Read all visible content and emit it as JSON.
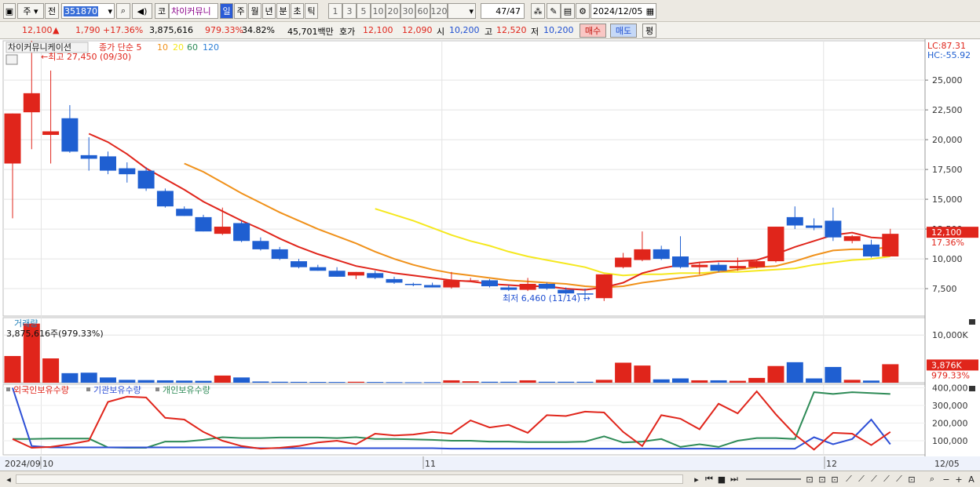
{
  "toolbar": {
    "market_label": "주",
    "prev_label": "전",
    "code": "351870",
    "market_short": "코",
    "stock_name": "차이커뮤니",
    "period_tabs": [
      "일",
      "주",
      "월",
      "년",
      "분",
      "초",
      "틱"
    ],
    "active_period": "일",
    "interval_buttons": [
      "1",
      "3",
      "5",
      "10",
      "20",
      "30",
      "60",
      "120"
    ],
    "page_count": "47/47",
    "date": "2024/12/05"
  },
  "infobar": {
    "price": "12,100",
    "change_arrow": "▲",
    "change": "1,790",
    "change_pct": "+17.36%",
    "volume": "3,875,616",
    "volume_ratio": "979.33%",
    "turnover": "34.82%",
    "trade_value": "45,701백만",
    "quote_label": "호가",
    "ask": "12,100",
    "bid": "12,090",
    "open_label": "시",
    "open": "10,200",
    "high_label": "고",
    "high": "12,520",
    "low_label": "저",
    "low": "10,200",
    "buy_label": "매수",
    "sell_label": "매도",
    "flat_label": "평"
  },
  "colors": {
    "up": "#e0251b",
    "down": "#1f5fd1",
    "ma5": "#e0251b",
    "ma10": "#f0911a",
    "ma20": "#f5e81e",
    "foreign": "#e0251b",
    "institution": "#2d4fd6",
    "individual": "#2e8b57"
  },
  "chart_data": [
    {
      "type": "candlestick",
      "title": "차이커뮤니케이션",
      "legend": [
        "종가 단순 5",
        "10",
        "20",
        "60",
        "120"
      ],
      "annotations": {
        "high_label": "최고 27,450 (09/30)",
        "low_label": "최저 6,460 (11/14)",
        "lc": "LC:87.31",
        "hc": "HC:-55.92",
        "last_price_label": "12,100",
        "last_pct_label": "17.36%"
      },
      "y_ticks": [
        7500,
        10000,
        12500,
        15000,
        17500,
        20000,
        22500,
        25000
      ],
      "y_tick_labels": [
        "7,500",
        "10,000",
        "12,500",
        "15,000",
        "17,500",
        "20,000",
        "22,500",
        "25,000"
      ],
      "ylim": [
        5200,
        28300
      ],
      "x_labels": [
        "2024/09",
        "10",
        "11",
        "12",
        "12/05"
      ],
      "candles": [
        {
          "o": 18000,
          "h": 22200,
          "l": 13400,
          "c": 22200
        },
        {
          "o": 22300,
          "h": 28300,
          "l": 19200,
          "c": 23900
        },
        {
          "o": 20400,
          "h": 25800,
          "l": 18000,
          "c": 20700
        },
        {
          "o": 21800,
          "h": 22900,
          "l": 18900,
          "c": 19000
        },
        {
          "o": 18700,
          "h": 20200,
          "l": 17400,
          "c": 18400
        },
        {
          "o": 18600,
          "h": 19000,
          "l": 17100,
          "c": 17400
        },
        {
          "o": 17600,
          "h": 18100,
          "l": 16400,
          "c": 17100
        },
        {
          "o": 17400,
          "h": 17700,
          "l": 15700,
          "c": 15900
        },
        {
          "o": 15700,
          "h": 15900,
          "l": 14300,
          "c": 14400
        },
        {
          "o": 14200,
          "h": 14400,
          "l": 13600,
          "c": 13600
        },
        {
          "o": 13500,
          "h": 13700,
          "l": 12300,
          "c": 12300
        },
        {
          "o": 12100,
          "h": 14300,
          "l": 12000,
          "c": 12700
        },
        {
          "o": 13000,
          "h": 13200,
          "l": 11400,
          "c": 11500
        },
        {
          "o": 11500,
          "h": 11800,
          "l": 10700,
          "c": 10800
        },
        {
          "o": 10800,
          "h": 11000,
          "l": 9900,
          "c": 10000
        },
        {
          "o": 9800,
          "h": 10000,
          "l": 9200,
          "c": 9300
        },
        {
          "o": 9300,
          "h": 9500,
          "l": 9000,
          "c": 9000
        },
        {
          "o": 9000,
          "h": 9300,
          "l": 8500,
          "c": 8500
        },
        {
          "o": 8600,
          "h": 8900,
          "l": 8300,
          "c": 8900
        },
        {
          "o": 8800,
          "h": 9000,
          "l": 8300,
          "c": 8400
        },
        {
          "o": 8300,
          "h": 8500,
          "l": 7900,
          "c": 8000
        },
        {
          "o": 7900,
          "h": 8000,
          "l": 7700,
          "c": 7800
        },
        {
          "o": 7800,
          "h": 8000,
          "l": 7600,
          "c": 7600
        },
        {
          "o": 7600,
          "h": 8900,
          "l": 7500,
          "c": 8200
        },
        {
          "o": 8200,
          "h": 8400,
          "l": 8100,
          "c": 8200
        },
        {
          "o": 8200,
          "h": 8300,
          "l": 7600,
          "c": 7700
        },
        {
          "o": 7600,
          "h": 7800,
          "l": 7300,
          "c": 7400
        },
        {
          "o": 7400,
          "h": 8400,
          "l": 7300,
          "c": 7900
        },
        {
          "o": 7900,
          "h": 8000,
          "l": 7400,
          "c": 7500
        },
        {
          "o": 7400,
          "h": 7600,
          "l": 7000,
          "c": 7100
        },
        {
          "o": 7100,
          "h": 7500,
          "l": 6460,
          "c": 7000
        },
        {
          "o": 6700,
          "h": 8700,
          "l": 6460,
          "c": 8700
        },
        {
          "o": 9300,
          "h": 10500,
          "l": 9200,
          "c": 10100
        },
        {
          "o": 9900,
          "h": 12300,
          "l": 9800,
          "c": 10800
        },
        {
          "o": 10800,
          "h": 11100,
          "l": 9900,
          "c": 10000
        },
        {
          "o": 10200,
          "h": 11900,
          "l": 9200,
          "c": 9300
        },
        {
          "o": 9300,
          "h": 9700,
          "l": 8700,
          "c": 9500
        },
        {
          "o": 9500,
          "h": 9700,
          "l": 8900,
          "c": 9000
        },
        {
          "o": 9200,
          "h": 10100,
          "l": 9000,
          "c": 9400
        },
        {
          "o": 9300,
          "h": 9900,
          "l": 9200,
          "c": 9800
        },
        {
          "o": 9800,
          "h": 12700,
          "l": 9700,
          "c": 12700
        },
        {
          "o": 13500,
          "h": 14400,
          "l": 12500,
          "c": 12800
        },
        {
          "o": 12800,
          "h": 13400,
          "l": 12400,
          "c": 12600
        },
        {
          "o": 13200,
          "h": 14300,
          "l": 11500,
          "c": 11800
        },
        {
          "o": 11500,
          "h": 12000,
          "l": 11300,
          "c": 11900
        },
        {
          "o": 11200,
          "h": 11600,
          "l": 10100,
          "c": 10200
        },
        {
          "o": 10200,
          "h": 12520,
          "l": 10200,
          "c": 12100
        }
      ],
      "ma5": [
        null,
        null,
        null,
        null,
        20500,
        19800,
        18800,
        17600,
        16700,
        15800,
        14800,
        14000,
        13200,
        12500,
        11700,
        11000,
        10400,
        9900,
        9400,
        9100,
        8800,
        8600,
        8400,
        8200,
        8100,
        7900,
        7800,
        7700,
        7700,
        7500,
        7400,
        7600,
        8000,
        8800,
        9200,
        9500,
        9700,
        9800,
        9800,
        9900,
        10400,
        11000,
        11500,
        12000,
        12200,
        11800,
        11700
      ],
      "ma10": [
        null,
        null,
        null,
        null,
        null,
        null,
        null,
        null,
        null,
        18000,
        17300,
        16400,
        15500,
        14700,
        13900,
        13200,
        12500,
        11900,
        11300,
        10600,
        10000,
        9500,
        9100,
        8800,
        8600,
        8400,
        8200,
        8100,
        8000,
        7900,
        7700,
        7600,
        7700,
        8000,
        8200,
        8400,
        8600,
        8900,
        9100,
        9300,
        9400,
        9800,
        10300,
        10700,
        10800,
        10800,
        11000
      ],
      "ma20": [
        null,
        null,
        null,
        null,
        null,
        null,
        null,
        null,
        null,
        null,
        null,
        null,
        null,
        null,
        null,
        null,
        null,
        null,
        null,
        14200,
        13700,
        13200,
        12600,
        12000,
        11500,
        11100,
        10600,
        10200,
        9900,
        9600,
        9300,
        8800,
        8600,
        8700,
        8700,
        8800,
        8800,
        8900,
        8900,
        9000,
        9100,
        9200,
        9500,
        9700,
        9900,
        10000,
        10200
      ],
      "volume": {
        "label": "거래량",
        "value_label": "3,875,616주(979.33%)",
        "y_tick_label": "10,000K",
        "last_label": "3,876K",
        "last_pct_label": "979.33%",
        "ylim_k": [
          0,
          13000
        ],
        "values_k": [
          5600,
          12400,
          5100,
          2000,
          2100,
          1100,
          600,
          550,
          500,
          450,
          400,
          1500,
          1100,
          250,
          200,
          180,
          160,
          150,
          200,
          150,
          120,
          100,
          120,
          500,
          300,
          200,
          200,
          500,
          200,
          200,
          200,
          600,
          4200,
          3600,
          700,
          900,
          500,
          500,
          400,
          1000,
          3500,
          4300,
          900,
          3300,
          600,
          450,
          3876
        ]
      },
      "holdings": {
        "labels": [
          "외국인보유수량",
          "기관보유수량",
          "개인보유수량"
        ],
        "y_tick_labels": [
          "100,000",
          "200,000",
          "300,000",
          "400,000"
        ],
        "ylim": [
          20000,
          420000
        ],
        "foreign": [
          110000,
          60000,
          65000,
          80000,
          100000,
          320000,
          350000,
          345000,
          230000,
          220000,
          150000,
          100000,
          70000,
          55000,
          60000,
          70000,
          90000,
          100000,
          80000,
          140000,
          130000,
          135000,
          150000,
          140000,
          215000,
          175000,
          190000,
          145000,
          245000,
          240000,
          265000,
          260000,
          150000,
          70000,
          245000,
          225000,
          165000,
          310000,
          255000,
          380000,
          250000,
          135000,
          50000,
          145000,
          140000,
          75000,
          150000
        ],
        "institution": [
          400000,
          70000,
          62000,
          62000,
          62000,
          62000,
          62000,
          62000,
          62000,
          62000,
          62000,
          62000,
          62000,
          58000,
          58000,
          58000,
          58000,
          58000,
          58000,
          58000,
          58000,
          58000,
          58000,
          55000,
          55000,
          55000,
          55000,
          55000,
          55000,
          55000,
          55000,
          55000,
          55000,
          55000,
          55000,
          55000,
          55000,
          55000,
          55000,
          55000,
          55000,
          55000,
          120000,
          80000,
          110000,
          220000,
          80000
        ],
        "individual": [
          110000,
          110000,
          112000,
          112000,
          112000,
          62000,
          60000,
          60000,
          95000,
          95000,
          105000,
          120000,
          115000,
          115000,
          118000,
          118000,
          118000,
          115000,
          120000,
          110000,
          110000,
          108000,
          105000,
          100000,
          100000,
          95000,
          95000,
          92000,
          92000,
          92000,
          95000,
          125000,
          90000,
          95000,
          110000,
          65000,
          80000,
          65000,
          100000,
          115000,
          115000,
          110000,
          375000,
          365000,
          375000,
          370000,
          365000
        ]
      }
    }
  ]
}
